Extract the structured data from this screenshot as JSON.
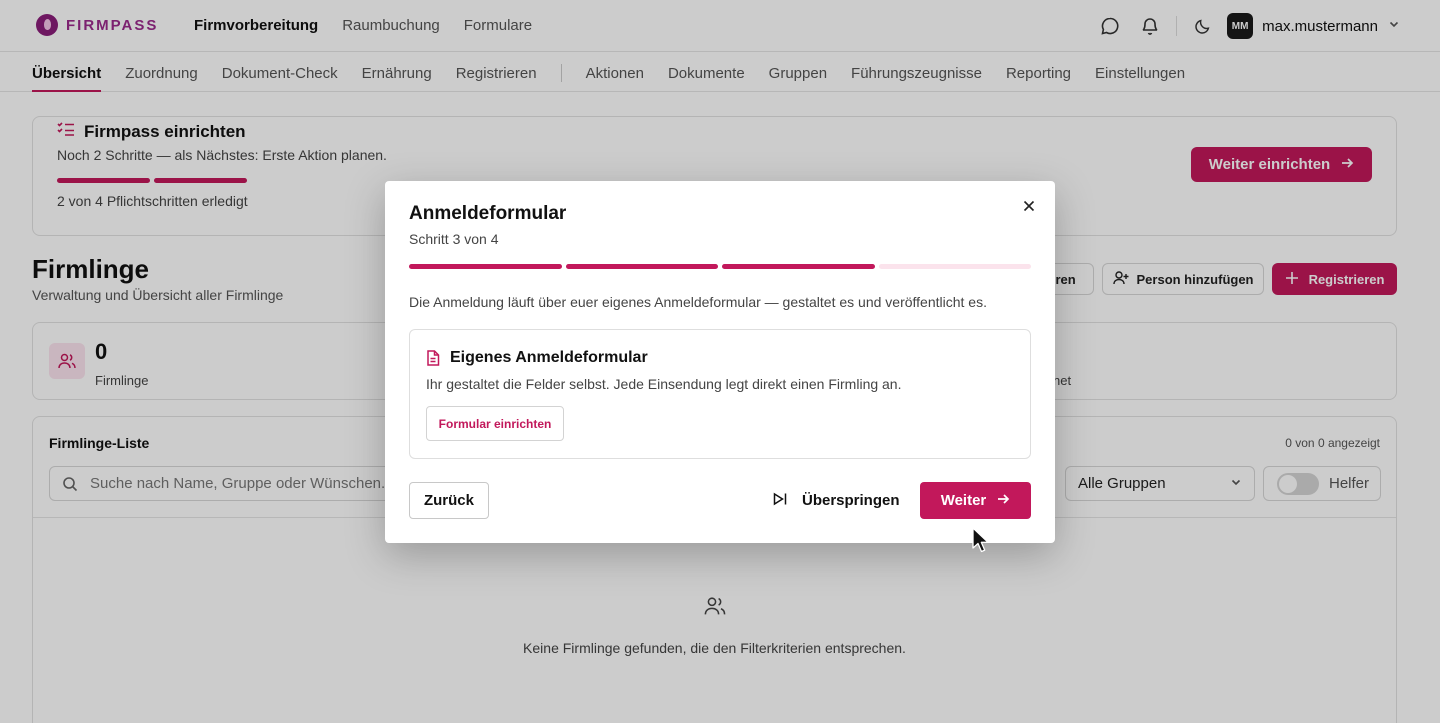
{
  "header": {
    "brand": "FIRMPASS",
    "nav": [
      {
        "label": "Firmvorbereitung",
        "active": true
      },
      {
        "label": "Raumbuchung",
        "active": false
      },
      {
        "label": "Formulare",
        "active": false
      }
    ],
    "icons": [
      "chat-icon",
      "bell-icon",
      "moon-icon"
    ],
    "user": {
      "initials": "MM",
      "name": "max.mustermann"
    }
  },
  "subnav": {
    "left": [
      "Übersicht",
      "Zuordnung",
      "Dokument-Check",
      "Ernährung",
      "Registrieren"
    ],
    "right": [
      "Aktionen",
      "Dokumente",
      "Gruppen",
      "Führungszeugnisse",
      "Reporting",
      "Einstellungen"
    ],
    "active": "Übersicht"
  },
  "setup": {
    "title": "Firmpass einrichten",
    "subtitle": "Noch 2 Schritte — als Nächstes: Erste Aktion planen.",
    "progress_done": 2,
    "progress_total": 4,
    "status": "2 von 4 Pflichtschritten erledigt",
    "button": "Weiter einrichten"
  },
  "page": {
    "title": "Firmlinge",
    "subtitle": "Verwaltung und Übersicht aller Firmlinge",
    "actions": {
      "import_partial": "eren",
      "add_person": "Person hinzufügen",
      "register": "Registrieren"
    }
  },
  "stats": {
    "count": "0",
    "label": "Firmlinge",
    "label_partial": "net"
  },
  "list": {
    "title": "Firmlinge-Liste",
    "count_text": "0 von 0 angezeigt",
    "search_placeholder": "Suche nach Name, Gruppe oder Wünschen...",
    "group_filter": "Alle Gruppen",
    "helper_label": "Helfer",
    "helper_on": false,
    "empty_text": "Keine Firmlinge gefunden, die den Filterkriterien entsprechen."
  },
  "modal": {
    "title": "Anmeldeformular",
    "step_text": "Schritt 3 von 4",
    "step_current": 3,
    "step_total": 4,
    "description": "Die Anmeldung läuft über euer eigenes Anmeldeformular — gestaltet es und veröffentlicht es.",
    "option": {
      "title": "Eigenes Anmeldeformular",
      "description": "Ihr gestaltet die Felder selbst. Jede Einsendung legt direkt einen Firmling an.",
      "button": "Formular einrichten"
    },
    "back": "Zurück",
    "skip": "Überspringen",
    "next": "Weiter"
  },
  "colors": {
    "accent": "#c2185b",
    "accent_light": "#fbe3ec",
    "brand": "#9b2a8d"
  }
}
